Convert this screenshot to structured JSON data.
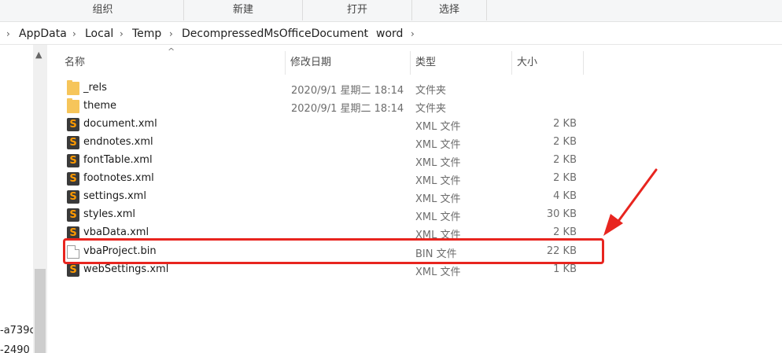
{
  "ribbon": {
    "groups": [
      {
        "label": "组织"
      },
      {
        "label": "新建"
      },
      {
        "label": "打开"
      },
      {
        "label": "选择"
      }
    ]
  },
  "breadcrumb": [
    "AppData",
    "Local",
    "Temp",
    "DecompressedMsOfficeDocument",
    "word"
  ],
  "nav": {
    "fragment_1": "-a739c",
    "fragment_2": "-2490"
  },
  "columns": {
    "name": "名称",
    "date": "修改日期",
    "type": "类型",
    "size": "大小"
  },
  "files": [
    {
      "name": "_rels",
      "date": "2020/9/1 星期二 18:14",
      "type": "文件夹",
      "size": "",
      "icon": "folder-icon"
    },
    {
      "name": "theme",
      "date": "2020/9/1 星期二 18:14",
      "type": "文件夹",
      "size": "",
      "icon": "folder-icon"
    },
    {
      "name": "document.xml",
      "date": "",
      "type": "XML 文件",
      "size": "2 KB",
      "icon": "sublime-text-icon"
    },
    {
      "name": "endnotes.xml",
      "date": "",
      "type": "XML 文件",
      "size": "2 KB",
      "icon": "sublime-text-icon"
    },
    {
      "name": "fontTable.xml",
      "date": "",
      "type": "XML 文件",
      "size": "2 KB",
      "icon": "sublime-text-icon"
    },
    {
      "name": "footnotes.xml",
      "date": "",
      "type": "XML 文件",
      "size": "2 KB",
      "icon": "sublime-text-icon"
    },
    {
      "name": "settings.xml",
      "date": "",
      "type": "XML 文件",
      "size": "4 KB",
      "icon": "sublime-text-icon"
    },
    {
      "name": "styles.xml",
      "date": "",
      "type": "XML 文件",
      "size": "30 KB",
      "icon": "sublime-text-icon"
    },
    {
      "name": "vbaData.xml",
      "date": "",
      "type": "XML 文件",
      "size": "2 KB",
      "icon": "sublime-text-icon"
    },
    {
      "name": "vbaProject.bin",
      "date": "",
      "type": "BIN 文件",
      "size": "22 KB",
      "icon": "blank-file-icon"
    },
    {
      "name": "webSettings.xml",
      "date": "",
      "type": "XML 文件",
      "size": "1 KB",
      "icon": "sublime-text-icon"
    }
  ],
  "colors": {
    "highlight": "#e8251f",
    "folder": "#f6c55a",
    "sublime_accent": "#ff9a00"
  }
}
